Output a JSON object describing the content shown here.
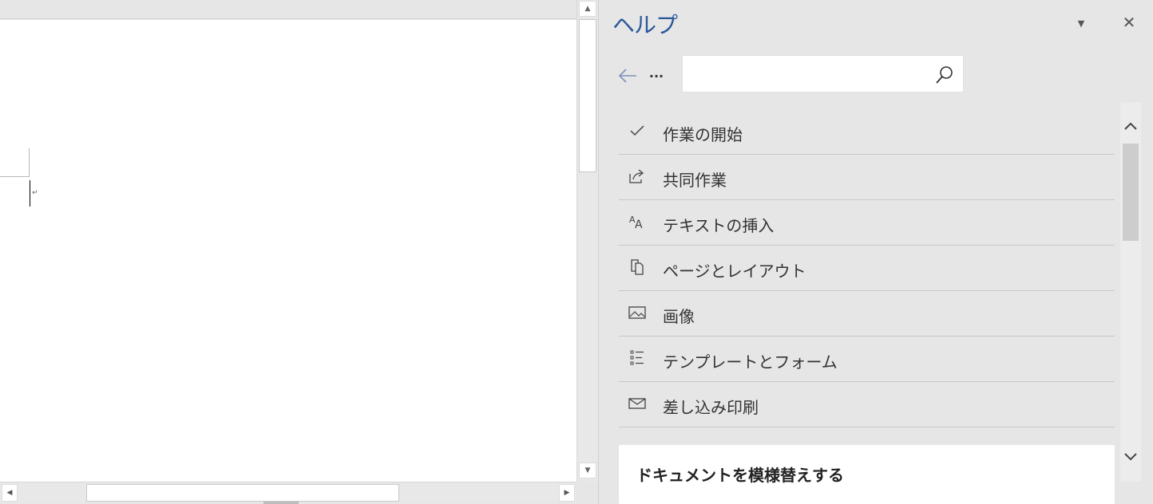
{
  "document": {
    "paragraph_mark": "↵"
  },
  "help_pane": {
    "title": "ヘルプ",
    "title_color": "#2b579a",
    "search": {
      "placeholder": "",
      "value": ""
    },
    "items": [
      {
        "label": "作業の開始",
        "icon": "checkmark-icon"
      },
      {
        "label": "共同作業",
        "icon": "share-icon"
      },
      {
        "label": "テキストの挿入",
        "icon": "font-size-icon"
      },
      {
        "label": "ページとレイアウト",
        "icon": "pages-icon"
      },
      {
        "label": "画像",
        "icon": "picture-icon"
      },
      {
        "label": "テンプレートとフォーム",
        "icon": "list-icon"
      },
      {
        "label": "差し込み印刷",
        "icon": "envelope-icon"
      }
    ],
    "card": {
      "title": "ドキュメントを模様替えする"
    }
  }
}
